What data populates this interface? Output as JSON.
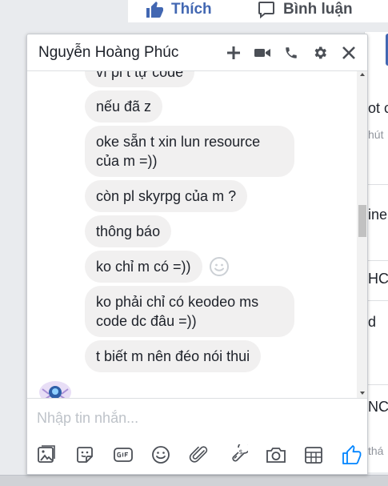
{
  "background": {
    "like_label": "Thích",
    "comment_label": "Bình luận",
    "right_fragments": [
      "ot c",
      "hút",
      "ine",
      "HC",
      "d",
      "NC",
      "thá"
    ]
  },
  "chat": {
    "title": "Nguyễn Hoàng Phúc",
    "compose_placeholder": "Nhập tin nhắn...",
    "messages": [
      {
        "text": "vì pl t tự code"
      },
      {
        "text": "nếu đã z"
      },
      {
        "text": "oke sẵn t xin lun resource của m =))"
      },
      {
        "text": "còn pl skyrpg của m ?"
      },
      {
        "text": "thông báo"
      },
      {
        "text": "ko chỉ m có =))"
      },
      {
        "text": "ko phải chỉ có keodeo ms code dc đâu =))"
      },
      {
        "text": "t biết m nên đéo nói thui"
      }
    ]
  },
  "colors": {
    "brand_blue": "#4267b2",
    "messenger_blue": "#0084ff",
    "bubble_gray": "#f1f0f0",
    "icon_gray": "#4b4f56"
  }
}
